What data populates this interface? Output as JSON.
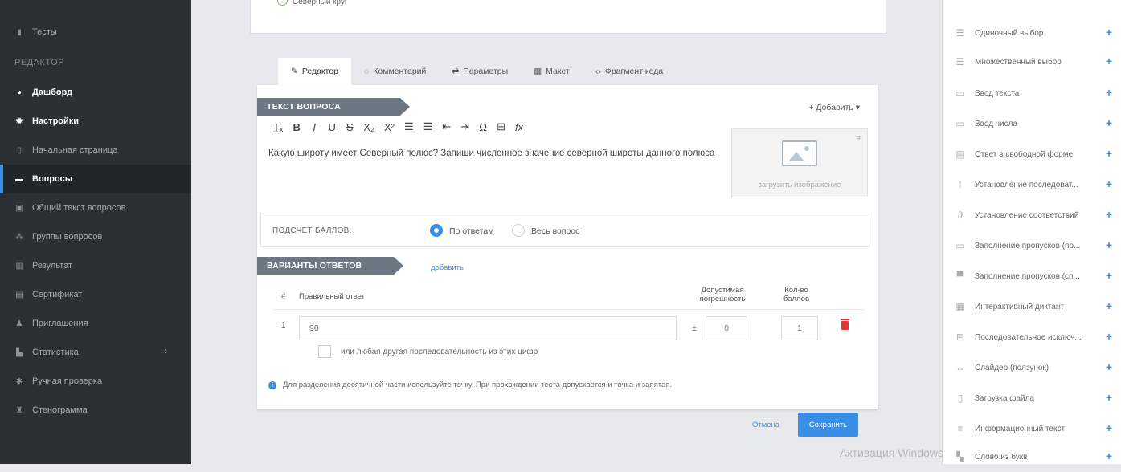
{
  "sidebar": {
    "tests": "Тесты",
    "editor_header": "РЕДАКТОР",
    "items": [
      {
        "label": "Дашборд",
        "icon": "dashboard-icon"
      },
      {
        "label": "Настройки",
        "icon": "gear-icon"
      },
      {
        "label": "Начальная страница",
        "icon": "page-icon"
      },
      {
        "label": "Вопросы",
        "icon": "questions-icon"
      },
      {
        "label": "Общий текст вопросов",
        "icon": "text-icon"
      },
      {
        "label": "Группы вопросов",
        "icon": "groups-icon"
      },
      {
        "label": "Результат",
        "icon": "result-icon"
      },
      {
        "label": "Сертификат",
        "icon": "certificate-icon"
      },
      {
        "label": "Приглашения",
        "icon": "invite-icon"
      },
      {
        "label": "Статистика",
        "icon": "stats-icon"
      },
      {
        "label": "Ручная проверка",
        "icon": "check-icon"
      },
      {
        "label": "Стенограмма",
        "icon": "transcript-icon"
      }
    ]
  },
  "top_card": {
    "option_label": "Северный круг"
  },
  "tabs": [
    {
      "label": "Редактор",
      "icon": "edit-icon"
    },
    {
      "label": "Комментарий",
      "icon": "comment-icon"
    },
    {
      "label": "Параметры",
      "icon": "sliders-icon"
    },
    {
      "label": "Макет",
      "icon": "layout-icon"
    },
    {
      "label": "Фрагмент кода",
      "icon": "code-icon"
    }
  ],
  "editor": {
    "question_ribbon": "ТЕКСТ ВОПРОСА",
    "add_label": "Добавить",
    "toolbar": [
      "T̲ₓ",
      "B",
      "I",
      "U",
      "S",
      "X₂",
      "X²",
      "☰",
      "☰",
      "⇤",
      "⇥",
      "Ω",
      "⊞",
      "fx"
    ],
    "question_text": "Какую широту имеет Северный полюс? Запиши численное значение северной широты данного полюса",
    "upload_caption": "загрузить изображение",
    "scoring_label": "ПОДСЧЕТ БАЛЛОВ:",
    "scoring_opt1": "По ответам",
    "scoring_opt2": "Весь вопрос",
    "answers_ribbon": "ВАРИАНТЫ ОТВЕТОВ",
    "add_answer": "добавить",
    "col_hash": "#",
    "col_correct": "Правильный ответ",
    "col_tolerance_1": "Допустимая",
    "col_tolerance_2": "погрешность",
    "col_points_1": "Кол-во",
    "col_points_2": "баллов",
    "row_number": "1",
    "answer_value": "90",
    "tolerance_value": "0",
    "points_value": "1",
    "any_sequence_label": "или любая другая последовательность из этих цифр",
    "info_text": "Для разделения десятичной части используйте точку. При прохождении теста допускается и точка и запятая.",
    "cancel_label": "Отмена",
    "save_label": "Сохранить"
  },
  "right_panel": [
    {
      "label": "Одиночный выбор",
      "icon": "single-choice-icon"
    },
    {
      "label": "Множественный выбор",
      "icon": "multi-choice-icon"
    },
    {
      "label": "Ввод текста",
      "icon": "text-input-icon"
    },
    {
      "label": "Ввод числа",
      "icon": "number-input-icon"
    },
    {
      "label": "Ответ в свободной форме",
      "icon": "free-form-icon"
    },
    {
      "label": "Установление последоват...",
      "icon": "sequence-icon"
    },
    {
      "label": "Установление соответствий",
      "icon": "match-icon"
    },
    {
      "label": "Заполнение пропусков (по...",
      "icon": "fill-gaps-icon"
    },
    {
      "label": "Заполнение пропусков (сп...",
      "icon": "fill-gaps-list-icon"
    },
    {
      "label": "Интерактивный диктант",
      "icon": "dictation-icon"
    },
    {
      "label": "Последовательное исключ...",
      "icon": "elimination-icon"
    },
    {
      "label": "Слайдер (ползунок)",
      "icon": "slider-icon"
    },
    {
      "label": "Загрузка файла",
      "icon": "file-icon"
    },
    {
      "label": "Информационный текст",
      "icon": "info-text-icon"
    },
    {
      "label": "Слово из букв",
      "icon": "letters-icon"
    }
  ],
  "watermark": "Активация Windows",
  "colors": {
    "accent": "#3a8ee6",
    "sidebar": "#2b3035",
    "ribbon": "#6c7781",
    "delete": "#e0363a"
  }
}
